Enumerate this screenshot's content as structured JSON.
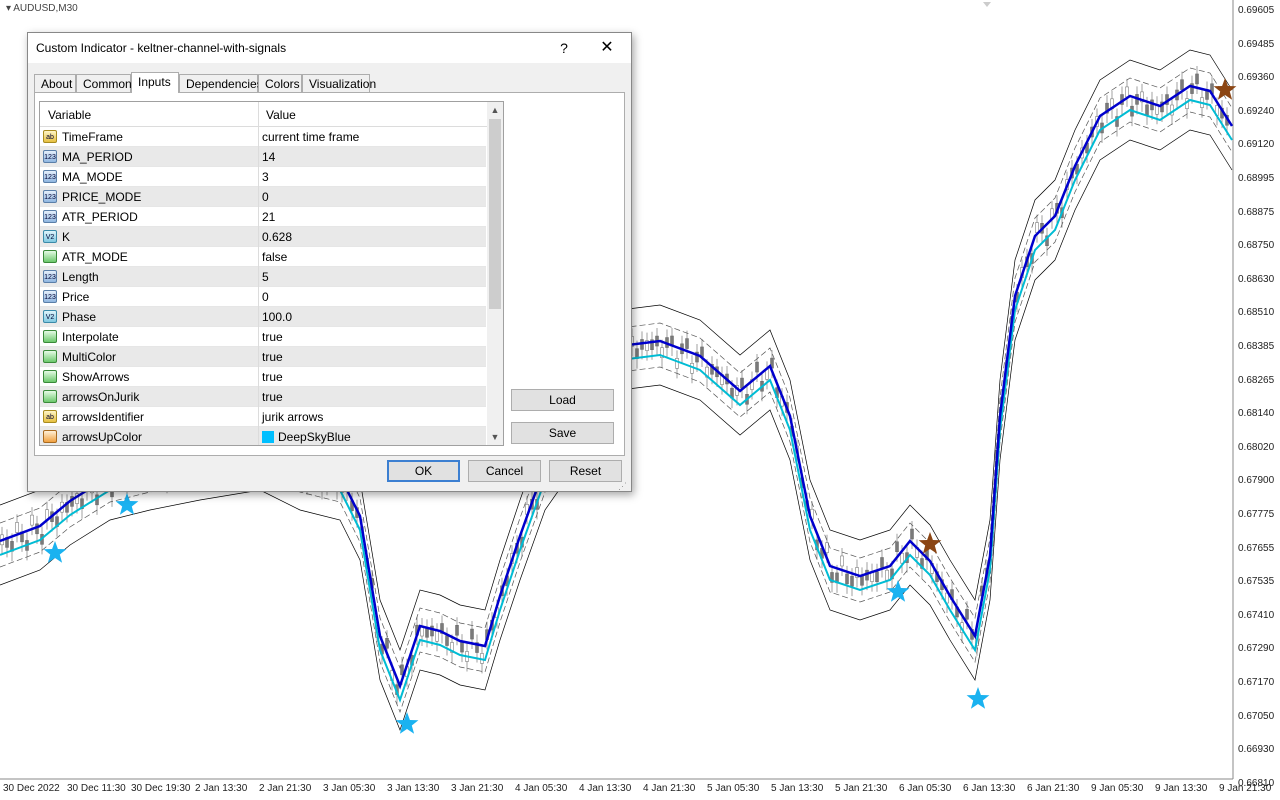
{
  "chart": {
    "symbol_label": "AUDUSD,M30",
    "price_axis": [
      "0.69605",
      "0.69485",
      "0.69360",
      "0.69240",
      "0.69120",
      "0.68995",
      "0.68875",
      "0.68750",
      "0.68630",
      "0.68510",
      "0.68385",
      "0.68265",
      "0.68140",
      "0.68020",
      "0.67900",
      "0.67775",
      "0.67655",
      "0.67535",
      "0.67410",
      "0.67290",
      "0.67170",
      "0.67050",
      "0.66930",
      "0.66810"
    ],
    "time_axis": [
      "30 Dec 2022",
      "30 Dec 11:30",
      "30 Dec 19:30",
      "2 Jan 13:30",
      "2 Jan 21:30",
      "3 Jan 05:30",
      "3 Jan 13:30",
      "3 Jan 21:30",
      "4 Jan 05:30",
      "4 Jan 13:30",
      "4 Jan 21:30",
      "5 Jan 05:30",
      "5 Jan 13:30",
      "5 Jan 21:30",
      "6 Jan 05:30",
      "6 Jan 13:30",
      "6 Jan 21:30",
      "9 Jan 05:30",
      "9 Jan 13:30",
      "9 Jan 21:30"
    ],
    "colors": {
      "up_line": "#0000cd",
      "down_line": "#c8009a",
      "mid_up": "#00bcd4",
      "mid_down": "#e020c0",
      "band": "#000000",
      "up_arrow": "#1ab2f0",
      "down_arrow": "#8b4513",
      "candle": "#7a7a7a"
    }
  },
  "dialog": {
    "title": "Custom Indicator - keltner-channel-with-signals",
    "help": "?",
    "close": "✕",
    "tabs": [
      {
        "label": "About"
      },
      {
        "label": "Common"
      },
      {
        "label": "Inputs"
      },
      {
        "label": "Dependencies"
      },
      {
        "label": "Colors"
      },
      {
        "label": "Visualization"
      }
    ],
    "active_tab": "Inputs",
    "table": {
      "col_variable": "Variable",
      "col_value": "Value",
      "rows": [
        {
          "icon": "str",
          "badge": "ab",
          "variable": "TimeFrame",
          "value": "current time frame"
        },
        {
          "icon": "int",
          "badge": "123",
          "variable": "MA_PERIOD",
          "value": "14"
        },
        {
          "icon": "int",
          "badge": "123",
          "variable": "MA_MODE",
          "value": "3"
        },
        {
          "icon": "int",
          "badge": "123",
          "variable": "PRICE_MODE",
          "value": "0"
        },
        {
          "icon": "int",
          "badge": "123",
          "variable": "ATR_PERIOD",
          "value": "21"
        },
        {
          "icon": "dbl",
          "badge": "V2",
          "variable": "K",
          "value": "0.628"
        },
        {
          "icon": "bool",
          "badge": "",
          "variable": "ATR_MODE",
          "value": "false"
        },
        {
          "icon": "int",
          "badge": "123",
          "variable": "Length",
          "value": "5"
        },
        {
          "icon": "int",
          "badge": "123",
          "variable": "Price",
          "value": "0"
        },
        {
          "icon": "dbl",
          "badge": "V2",
          "variable": "Phase",
          "value": "100.0"
        },
        {
          "icon": "bool",
          "badge": "",
          "variable": "Interpolate",
          "value": "true"
        },
        {
          "icon": "bool",
          "badge": "",
          "variable": "MultiColor",
          "value": "true"
        },
        {
          "icon": "bool",
          "badge": "",
          "variable": "ShowArrows",
          "value": "true"
        },
        {
          "icon": "bool",
          "badge": "",
          "variable": "arrowsOnJurik",
          "value": "true"
        },
        {
          "icon": "str",
          "badge": "ab",
          "variable": "arrowsIdentifier",
          "value": "jurik arrows"
        },
        {
          "icon": "clr",
          "badge": "",
          "variable": "arrowsUpColor",
          "value": "DeepSkyBlue",
          "swatch": "#00bfff"
        }
      ]
    },
    "load_label": "Load",
    "save_label": "Save",
    "ok_label": "OK",
    "cancel_label": "Cancel",
    "reset_label": "Reset"
  }
}
